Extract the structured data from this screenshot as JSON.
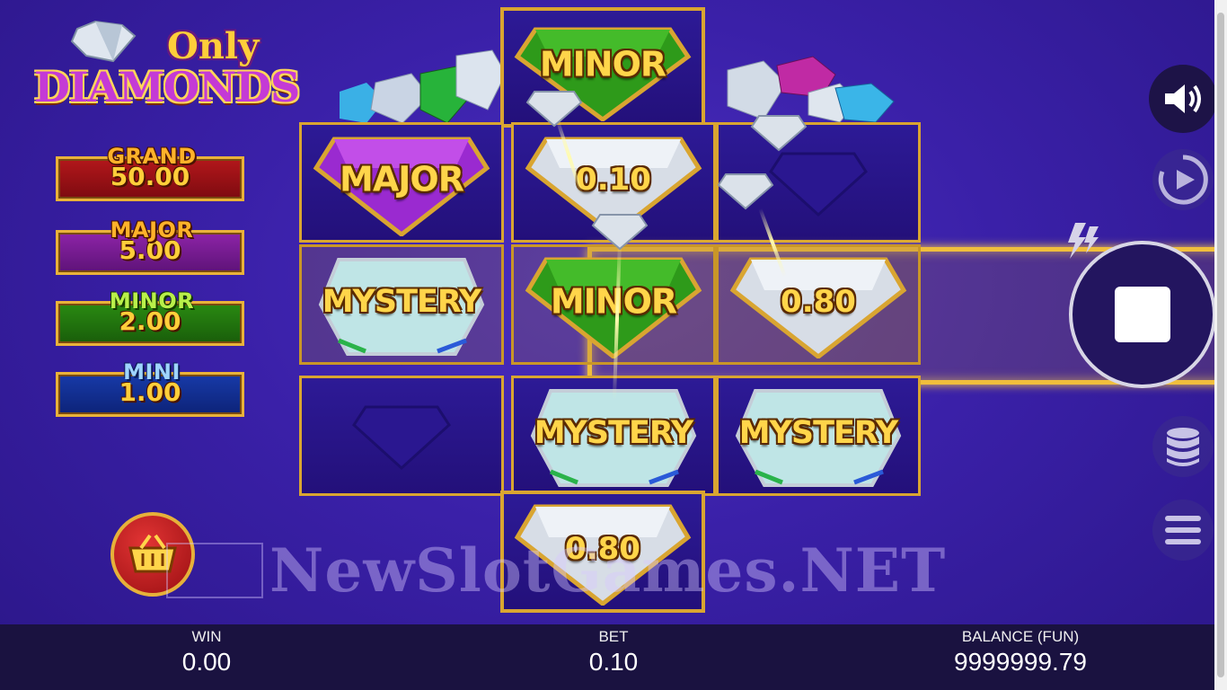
{
  "logo": {
    "line1": "Only",
    "line2": "DIAMONDS"
  },
  "jackpots": [
    {
      "name": "GRAND",
      "value": "50.00"
    },
    {
      "name": "MAJOR",
      "value": "5.00"
    },
    {
      "name": "MINOR",
      "value": "2.00"
    },
    {
      "name": "MINI",
      "value": "1.00"
    }
  ],
  "grid": {
    "top": "MINOR",
    "row1": [
      "MAJOR",
      "0.10",
      ""
    ],
    "row2": [
      "MYSTERY",
      "MINOR",
      "0.80"
    ],
    "row3": [
      "",
      "MYSTERY",
      "MYSTERY"
    ],
    "bottom": "0.80"
  },
  "watermark": "NewSlotGames.NET",
  "bottom_bar": {
    "win_label": "WIN",
    "win_value": "0.00",
    "bet_label": "BET",
    "bet_value": "0.10",
    "balance_label": "BALANCE (FUN)",
    "balance_value": "9999999.79"
  },
  "icons": {
    "sound": "speaker-icon",
    "autoplay": "autoplay-icon",
    "spin": "stop-icon",
    "turbo": "lightning-icon",
    "bet": "coin-stack-icon",
    "menu": "hamburger-icon",
    "shop": "basket-icon"
  },
  "colors": {
    "gold": "#e9b23a",
    "bg": "#3a20a8",
    "grand": "#b3171b",
    "major": "#8d24a8",
    "minor": "#2a8a12",
    "mini": "#173aa8"
  }
}
